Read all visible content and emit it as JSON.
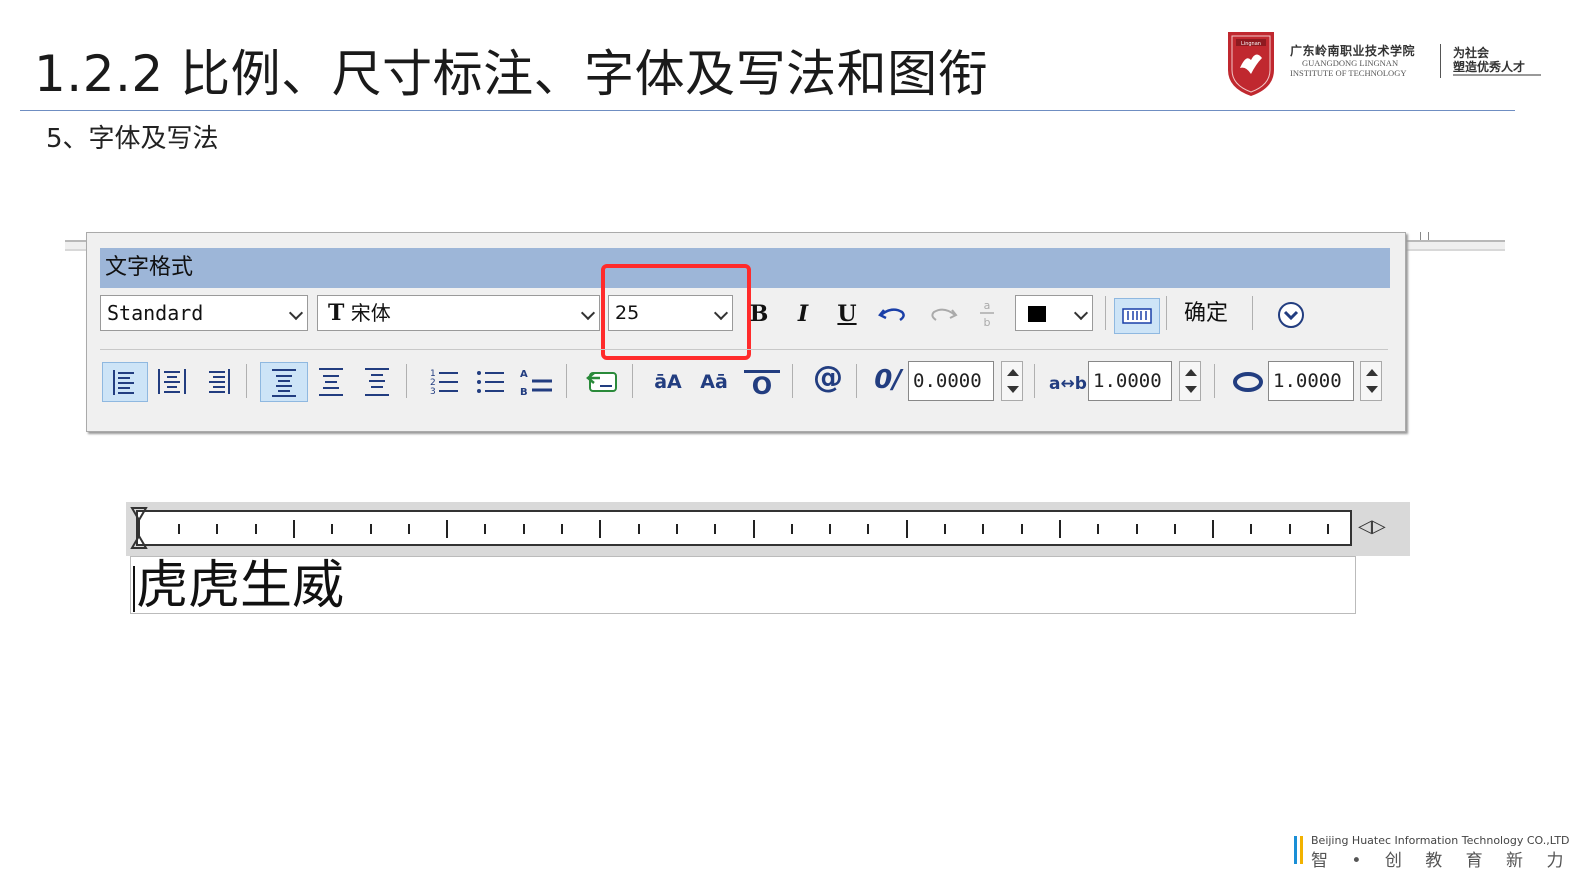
{
  "slide": {
    "title": "1.2.2 比例、尺寸标注、字体及写法和图衔",
    "section": "5、字体及写法"
  },
  "logo": {
    "badge_text": "Lingnan",
    "school_cn": "广东岭南职业技术学院",
    "school_en_line1": "GUANGDONG LINGNAN",
    "school_en_line2": "INSTITUTE OF TECHNOLOGY",
    "slogan_line1": "为社会",
    "slogan_line2": "塑造优秀人才",
    "brand_color": "#c0282f"
  },
  "dialog": {
    "title": "文字格式",
    "style_value": "Standard",
    "font_value": "宋体",
    "font_icon": "T",
    "height_value": "25",
    "bold_label": "B",
    "italic_label": "I",
    "underline_label": "U",
    "confirm_label": "确定",
    "case_upper_label": "āA",
    "case_lower_label": "Aā",
    "overline_label": "O",
    "symbol_label": "@",
    "oblique_label": "0/",
    "oblique_value": "0.0000",
    "tracking_label": "a↔b",
    "tracking_value": "1.0000",
    "width_value": "1.0000",
    "color_swatch": "#000000",
    "title_bar_color": "#9db6d8"
  },
  "editor": {
    "text": "虎虎生威",
    "ruler_end_label": "◁▷"
  },
  "footer": {
    "company_en": "Beijing Huatec Information Technology CO.,LTD",
    "slogan_cn": "智 • 创 教 育 新 力 量"
  },
  "highlight_color": "#ff2b2b"
}
